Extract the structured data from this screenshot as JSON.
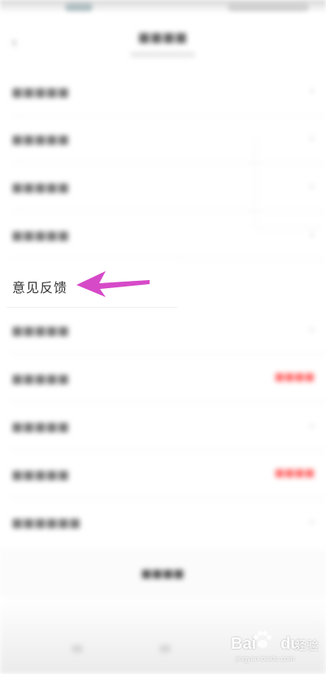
{
  "highlighted_item": {
    "label": "意见反馈"
  },
  "watermark": {
    "brand": "Bai",
    "brand_suffix": "du",
    "product": "经验",
    "domain": "jingyan.baidu.com"
  },
  "colors": {
    "arrow": "#d64ac8",
    "background": "#ffffff",
    "label_text": "#333333"
  },
  "icons": {
    "annotation": "arrow-left-icon",
    "watermark_logo": "paw-icon"
  }
}
